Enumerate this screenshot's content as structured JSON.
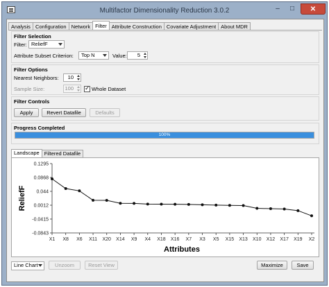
{
  "window": {
    "title": "Multifactor Dimensionality Reduction 3.0.2",
    "minimize_glyph": "–",
    "maximize_glyph": "□",
    "close_glyph": "✕"
  },
  "tabs": [
    {
      "label": "Analysis"
    },
    {
      "label": "Configuration"
    },
    {
      "label": "Network"
    },
    {
      "label": "Filter"
    },
    {
      "label": "Attribute Construction"
    },
    {
      "label": "Covariate Adjustment"
    },
    {
      "label": "About MDR"
    }
  ],
  "active_tab": "Filter",
  "filter_selection": {
    "title": "Filter Selection",
    "filter_label": "Filter:",
    "filter_value": "ReliefF",
    "criterion_label": "Attribute Subset Criterion:",
    "criterion_value": "Top N",
    "value_label": "Value:",
    "value": "5"
  },
  "filter_options": {
    "title": "Filter Options",
    "neighbors_label": "Nearest Neighbors:",
    "neighbors_value": "10",
    "sample_label": "Sample Size:",
    "sample_value": "100",
    "whole_dataset_label": "Whole Dataset",
    "whole_dataset_checked": true
  },
  "filter_controls": {
    "title": "Filter Controls",
    "apply_label": "Apply",
    "revert_label": "Revert Datafile",
    "defaults_label": "Defaults"
  },
  "progress": {
    "title": "Progress Completed",
    "percent": 100,
    "text": "100%"
  },
  "subtabs": [
    {
      "label": "Landscape"
    },
    {
      "label": "Filtered Datafile"
    }
  ],
  "bottom_bar": {
    "chart_type_value": "Line Chart",
    "unzoom_label": "Unzoom",
    "reset_view_label": "Reset View",
    "maximize_label": "Maximize",
    "save_label": "Save"
  },
  "colors": {
    "accent": "#3a8fde",
    "window_frame": "#9cb0c8",
    "close_button": "#c74a3a"
  },
  "chart_data": {
    "type": "line",
    "xlabel": "Attributes",
    "ylabel": "ReliefF",
    "categories": [
      "X1",
      "X8",
      "X6",
      "X11",
      "X20",
      "X14",
      "X9",
      "X4",
      "X18",
      "X16",
      "X7",
      "X3",
      "X5",
      "X15",
      "X13",
      "X10",
      "X12",
      "X17",
      "X19",
      "X2"
    ],
    "values": [
      0.0825,
      0.0525,
      0.0455,
      0.0165,
      0.0162,
      0.0072,
      0.0068,
      0.0048,
      0.0045,
      0.0042,
      0.0035,
      0.0025,
      0.0015,
      0.0008,
      0.0002,
      -0.0085,
      -0.0095,
      -0.0105,
      -0.0155,
      -0.0315
    ],
    "yticks": [
      "0.1295",
      "0.0868",
      "0.044",
      "0.0012",
      "-0.0415",
      "-0.0843"
    ],
    "ylim": [
      -0.0843,
      0.1295
    ],
    "grid": false
  }
}
